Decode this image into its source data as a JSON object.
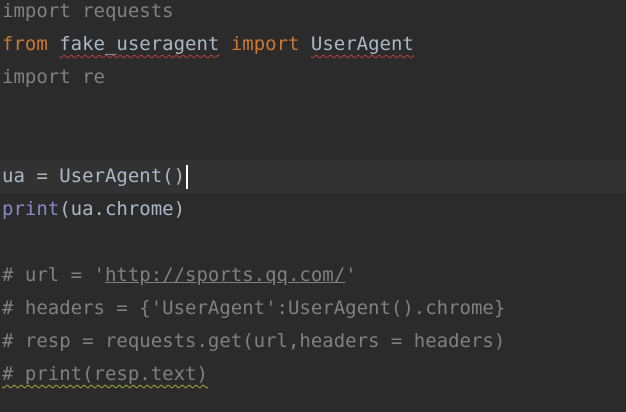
{
  "editor": {
    "lines": {
      "l1": {
        "kw": "import",
        "rest": " requests"
      },
      "l2": {
        "kw1": "from",
        "module": "fake_useragent",
        "kw2": "import",
        "name": "UserAgent"
      },
      "l3": {
        "kw": "import",
        "rest": " re"
      },
      "l4": {
        "text": "ua = UserAgent()"
      },
      "l5": {
        "builtin": "print",
        "rest": "(ua.chrome)"
      },
      "l6": {
        "prefix": "# url = '",
        "link": "http://sports.qq.com/",
        "suffix": "'"
      },
      "l7": {
        "text": "# headers = {'UserAgent':UserAgent().chrome}"
      },
      "l8": {
        "text": "# resp = requests.get(url,headers = headers)"
      },
      "l9": {
        "text": "# print(resp.text)"
      }
    }
  },
  "colors": {
    "background": "#2b2b2b",
    "current_line": "#323232",
    "keyword": "#cc7832",
    "builtin": "#8888c6",
    "text": "#a9b7c6",
    "comment": "#808080",
    "error_squiggle": "#bc3f3c",
    "warning_squiggle": "#a5a53a"
  }
}
